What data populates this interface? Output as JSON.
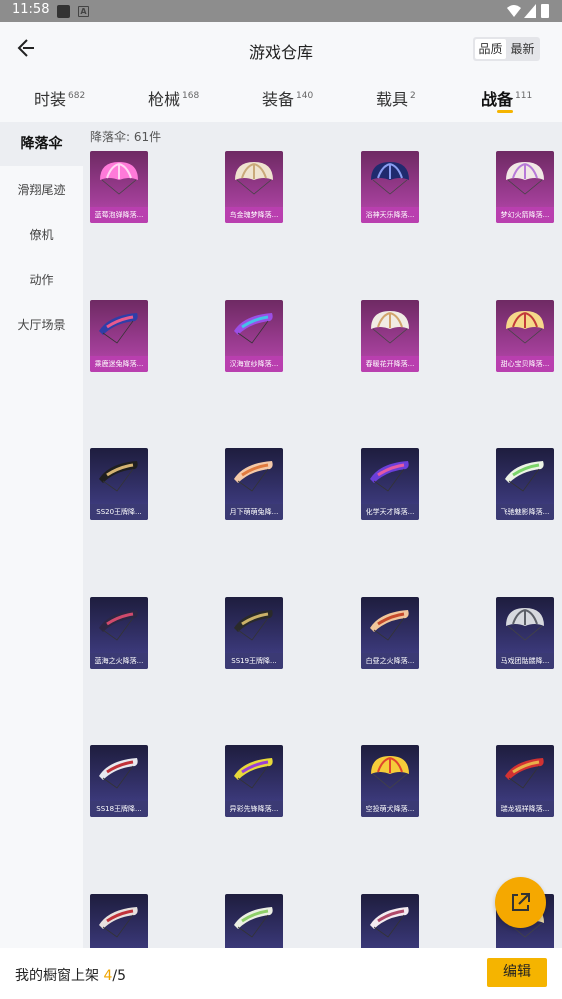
{
  "status_bar": {
    "time": "11:58"
  },
  "header": {
    "title": "游戏仓库",
    "sort_quality": "品质",
    "sort_newest": "最新"
  },
  "tabs": [
    {
      "label": "时装",
      "count": "682"
    },
    {
      "label": "枪械",
      "count": "168"
    },
    {
      "label": "装备",
      "count": "140"
    },
    {
      "label": "载具",
      "count": "2"
    },
    {
      "label": "战备",
      "count": "111"
    }
  ],
  "sidebar": [
    {
      "label": "降落伞"
    },
    {
      "label": "滑翔尾迹"
    },
    {
      "label": "僚机"
    },
    {
      "label": "动作"
    },
    {
      "label": "大厅场景"
    }
  ],
  "content": {
    "count_text": "降落伞: 61件"
  },
  "items": [
    {
      "name": "蓝莓泡弹降落...",
      "bg": "pink",
      "shape": "dome",
      "c1": "#ff7ad9",
      "c2": "#ffd6f2"
    },
    {
      "name": "鸟金瑰梦降落...",
      "bg": "pink",
      "shape": "dome",
      "c1": "#efe3cf",
      "c2": "#c9a97a"
    },
    {
      "name": "浴神天乐降落...",
      "bg": "pink",
      "shape": "dome",
      "c1": "#1f2a6e",
      "c2": "#8a9cf0"
    },
    {
      "name": "梦幻火箭降落...",
      "bg": "pink",
      "shape": "dome",
      "c1": "#f1e8e6",
      "c2": "#b77ad8"
    },
    {
      "name": "乘鹿迷兔降落...",
      "bg": "pink",
      "shape": "wing",
      "c1": "#2f3ea8",
      "c2": "#e85a8e"
    },
    {
      "name": "汉海宣纱降落...",
      "bg": "pink",
      "shape": "wing",
      "c1": "#9b4fe6",
      "c2": "#45c2e8"
    },
    {
      "name": "春暖花开降落...",
      "bg": "pink",
      "shape": "dome",
      "c1": "#f1ece4",
      "c2": "#d2a46c"
    },
    {
      "name": "甜心宝贝降落...",
      "bg": "pink",
      "shape": "dome",
      "c1": "#f6d88a",
      "c2": "#c23a3a"
    },
    {
      "name": "SS20王牌降...",
      "bg": "purple",
      "shape": "wing",
      "c1": "#1f1f1f",
      "c2": "#d4b373"
    },
    {
      "name": "月下萌萌兔降...",
      "bg": "purple",
      "shape": "wing",
      "c1": "#f4c9a8",
      "c2": "#e07a3f"
    },
    {
      "name": "化学天才降落...",
      "bg": "purple",
      "shape": "wing",
      "c1": "#6b3fd9",
      "c2": "#e45aa4"
    },
    {
      "name": "飞驰魅影降落...",
      "bg": "purple",
      "shape": "wing",
      "c1": "#ecf4e6",
      "c2": "#7bd56a"
    },
    {
      "name": "蓝海之火降落...",
      "bg": "purple",
      "shape": "wing",
      "c1": "#2c2744",
      "c2": "#d04a6c"
    },
    {
      "name": "SS19王牌降...",
      "bg": "purple",
      "shape": "wing",
      "c1": "#2a2a2a",
      "c2": "#cbb269"
    },
    {
      "name": "白昼之火降落...",
      "bg": "purple",
      "shape": "wing",
      "c1": "#f1c69b",
      "c2": "#c64a2c"
    },
    {
      "name": "马戏团骷髅降...",
      "bg": "purple",
      "shape": "dome",
      "c1": "#d7d9de",
      "c2": "#5d6068"
    },
    {
      "name": "SS18王牌降...",
      "bg": "purple",
      "shape": "wing",
      "c1": "#e8e8ee",
      "c2": "#c0323a"
    },
    {
      "name": "异彩先锋降落...",
      "bg": "purple",
      "shape": "wing",
      "c1": "#e8d93a",
      "c2": "#9a3fd6"
    },
    {
      "name": "空投萌犬降落...",
      "bg": "purple",
      "shape": "dome",
      "c1": "#f5cd3a",
      "c2": "#e0462e"
    },
    {
      "name": "瑞龙福祥降落...",
      "bg": "purple",
      "shape": "wing",
      "c1": "#d23232",
      "c2": "#e8b04a"
    },
    {
      "name": "",
      "bg": "purple",
      "shape": "wing",
      "c1": "#e7e1de",
      "c2": "#c0323a"
    },
    {
      "name": "",
      "bg": "purple",
      "shape": "wing",
      "c1": "#ecf0e4",
      "c2": "#8fd06a"
    },
    {
      "name": "",
      "bg": "purple",
      "shape": "wing",
      "c1": "#f4ecf0",
      "c2": "#b04a6a"
    },
    {
      "name": "",
      "bg": "purple",
      "shape": "dome",
      "c1": "#e8d7a4",
      "c2": "#a86c2a"
    }
  ],
  "bottom_bar": {
    "text": "我的橱窗上架",
    "current": "4",
    "separator": "/",
    "total": "5",
    "edit_label": "编辑"
  }
}
